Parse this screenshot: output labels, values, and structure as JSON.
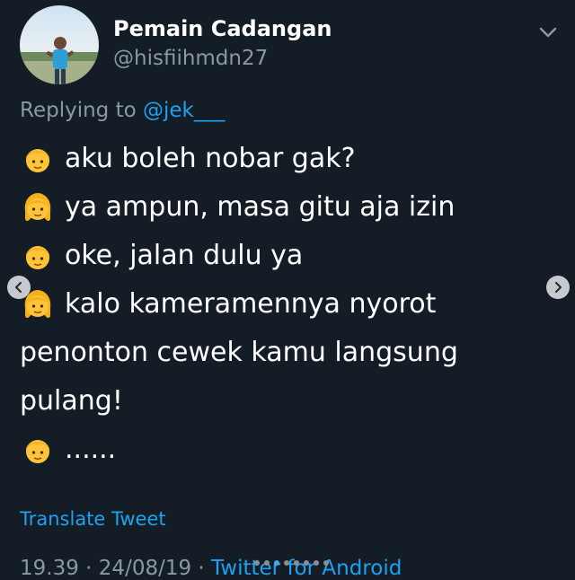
{
  "tweet": {
    "display_name": "Pemain Cadangan",
    "handle": "@hisfiihmdn27",
    "replying_prefix": "Replying to ",
    "replying_to": "@jek___",
    "lines": [
      {
        "emoji": "boy-emoji",
        "text": "aku boleh nobar gak?"
      },
      {
        "emoji": "girl-emoji",
        "text": "ya ampun, masa gitu aja izin"
      },
      {
        "emoji": "boy-emoji",
        "text": "oke, jalan dulu ya"
      },
      {
        "emoji": "girl-emoji",
        "text": "kalo kameramennya nyorot"
      },
      {
        "emoji": null,
        "text": "penonton cewek kamu langsung"
      },
      {
        "emoji": null,
        "text": "pulang!"
      },
      {
        "emoji": "boy-emoji",
        "text": "......"
      }
    ],
    "translate_label": "Translate Tweet",
    "time": "19.39",
    "date": "24/08/19",
    "separator": " · ",
    "source": "Twitter for Android"
  },
  "colors": {
    "background": "#141d26",
    "text": "#ffffff",
    "secondary": "#8899a6",
    "link": "#1da1f2"
  },
  "carousel": {
    "total_dots": 8,
    "active_index": 2
  }
}
